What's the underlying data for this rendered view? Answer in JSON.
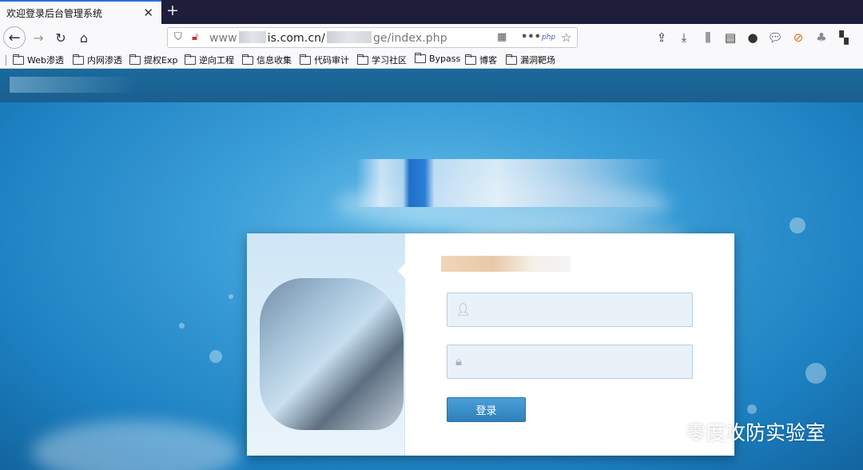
{
  "browser": {
    "tab": {
      "title": "欢迎登录后台管理系统",
      "close_icon": "close-icon"
    },
    "new_tab_label": "+",
    "url": {
      "prefix": "www",
      "middle": "is.com.cn/",
      "suffix": "ge/index.php"
    },
    "bookmarks": [
      "Web渗透",
      "内网渗透",
      "提权Exp",
      "逆向工程",
      "信息收集",
      "代码审计",
      "学习社区",
      "Bypass",
      "博客",
      "漏洞靶场"
    ]
  },
  "login": {
    "username_placeholder": "",
    "password_placeholder": "",
    "submit_label": "登录"
  },
  "watermark": {
    "text": "零度攻防实验室"
  }
}
